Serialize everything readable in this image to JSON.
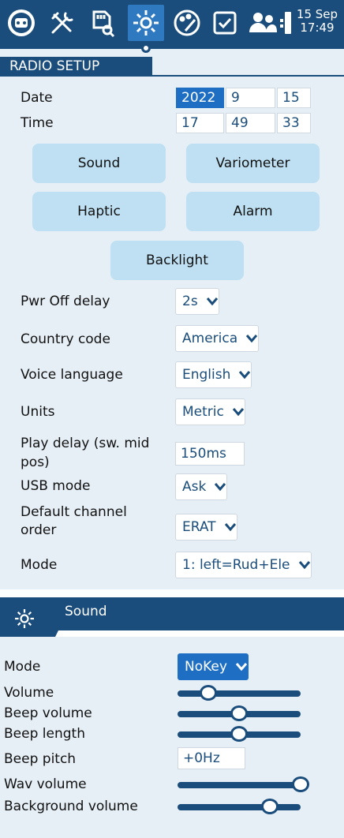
{
  "topbar": {
    "icons": [
      "model-icon",
      "tools-icon",
      "sd-card-icon",
      "radio-settings-icon",
      "theme-palette-icon",
      "checklist-icon",
      "users-icon",
      "battery-icon"
    ],
    "clock_date": "15 Sep",
    "clock_time": "17:49",
    "colors": {
      "bar": "#1a4d7b",
      "selected": "#2f79c0"
    }
  },
  "section": {
    "title": "RADIO SETUP"
  },
  "date": {
    "label": "Date",
    "year": "2022",
    "month": "9",
    "day": "15"
  },
  "time": {
    "label": "Time",
    "hour": "17",
    "minute": "49",
    "second": "33"
  },
  "buttons": {
    "sound": "Sound",
    "variometer": "Variometer",
    "haptic": "Haptic",
    "alarm": "Alarm",
    "backlight": "Backlight"
  },
  "settings": {
    "pwr_off": {
      "label": "Pwr Off delay",
      "value": "2s"
    },
    "country": {
      "label": "Country code",
      "value": "America"
    },
    "voice": {
      "label": "Voice language",
      "value": "English"
    },
    "units": {
      "label": "Units",
      "value": "Metric"
    },
    "play_delay": {
      "label_1": "Play delay (sw. mid",
      "label_2": "pos)",
      "value": "150ms"
    },
    "usb": {
      "label": "USB mode",
      "value": "Ask"
    },
    "channel_order": {
      "label_1": "Default channel",
      "label_2": "order",
      "value": "ERAT"
    },
    "mode": {
      "label": "Mode",
      "value": "1: left=Rud+Ele"
    }
  },
  "sound": {
    "title": "Sound",
    "mode": {
      "label": "Mode",
      "value": "NoKey"
    },
    "volume": {
      "label": "Volume",
      "level": 0.25
    },
    "beep_volume": {
      "label": "Beep volume",
      "level": 0.5
    },
    "beep_length": {
      "label": "Beep length",
      "level": 0.5
    },
    "beep_pitch": {
      "label": "Beep pitch",
      "value": "+0Hz"
    },
    "wav_volume": {
      "label": "Wav volume",
      "level": 1.0
    },
    "background_volume": {
      "label": "Background volume",
      "level": 0.75
    }
  }
}
